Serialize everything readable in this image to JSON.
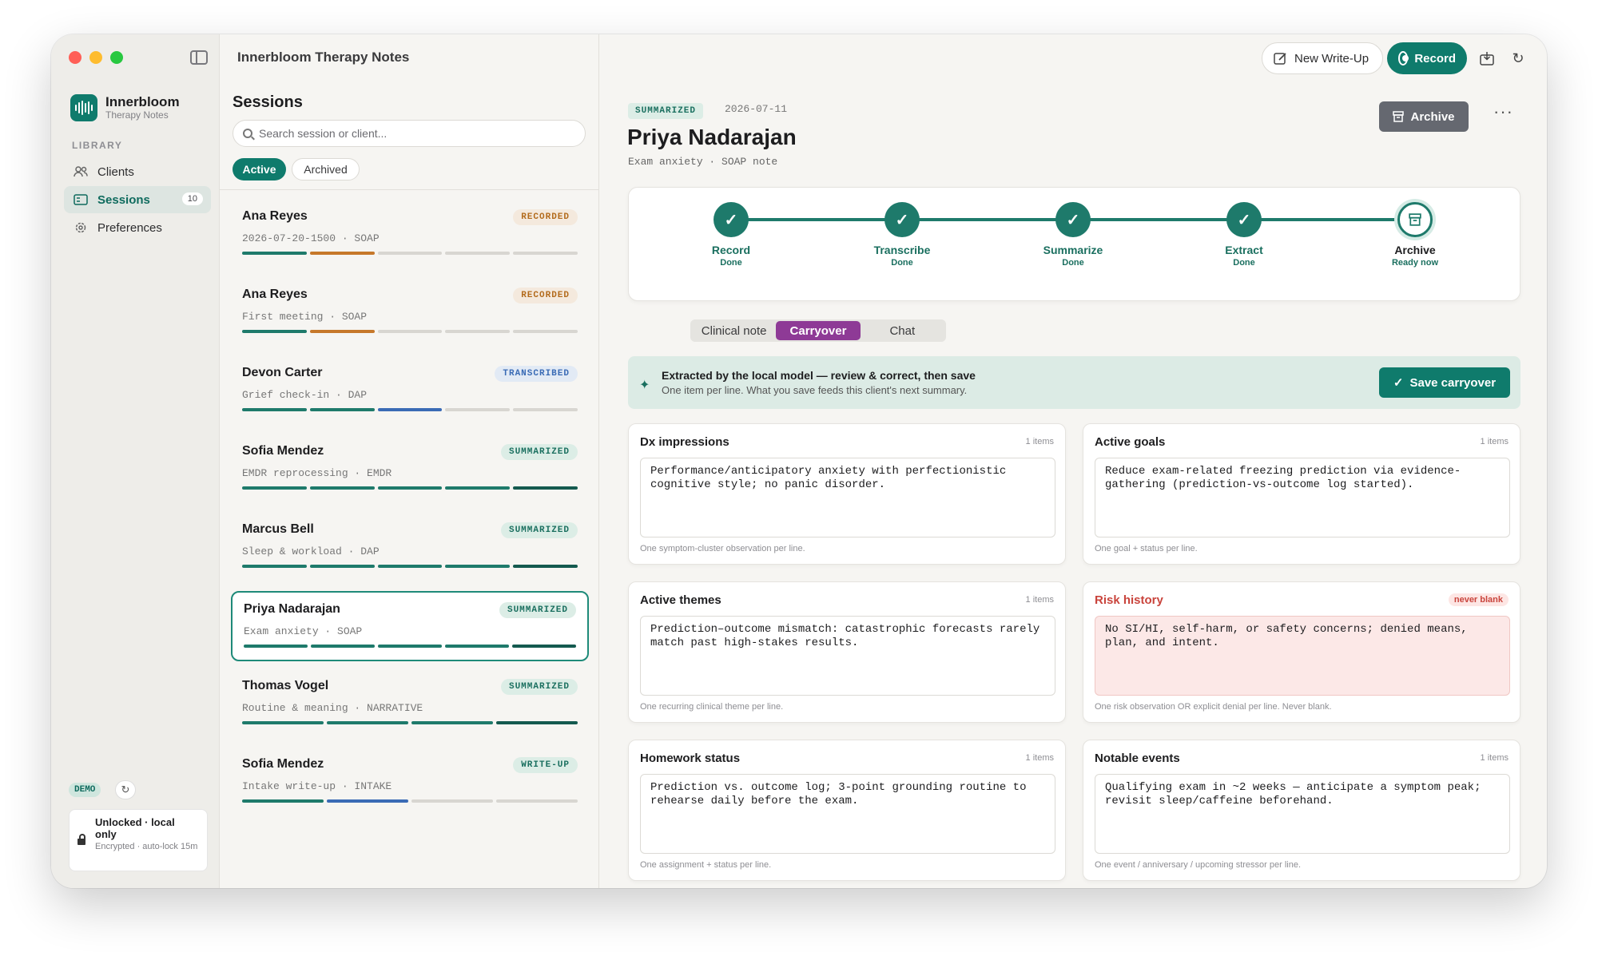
{
  "app_title": "Innerbloom Therapy Notes",
  "brand": {
    "name": "Innerbloom",
    "subtitle": "Therapy Notes"
  },
  "sidebar": {
    "library_label": "LIBRARY",
    "items": [
      {
        "label": "Clients",
        "icon": "clients-icon"
      },
      {
        "label": "Sessions",
        "icon": "sessions-icon",
        "count": "10",
        "active": true
      },
      {
        "label": "Preferences",
        "icon": "gear-icon"
      }
    ],
    "demo_badge": "DEMO",
    "lock": {
      "title": "Unlocked · local only",
      "subtitle": "Encrypted · auto-lock 15m"
    }
  },
  "sessions": {
    "heading": "Sessions",
    "search_placeholder": "Search session or client...",
    "filters": [
      "Active",
      "Archived"
    ],
    "items": [
      {
        "name": "Ana Reyes",
        "sub": "2026-07-20-1500 · SOAP",
        "status": "RECORDED"
      },
      {
        "name": "Ana Reyes",
        "sub": "First meeting · SOAP",
        "status": "RECORDED"
      },
      {
        "name": "Devon Carter",
        "sub": "Grief check-in · DAP",
        "status": "TRANSCRIBED"
      },
      {
        "name": "Sofia Mendez",
        "sub": "EMDR reprocessing · EMDR",
        "status": "SUMMARIZED"
      },
      {
        "name": "Marcus Bell",
        "sub": "Sleep & workload · DAP",
        "status": "SUMMARIZED"
      },
      {
        "name": "Priya Nadarajan",
        "sub": "Exam anxiety · SOAP",
        "status": "SUMMARIZED",
        "selected": true
      },
      {
        "name": "Thomas Vogel",
        "sub": "Routine & meaning · NARRATIVE",
        "status": "SUMMARIZED"
      },
      {
        "name": "Sofia Mendez",
        "sub": "Intake write-up · INTAKE",
        "status": "WRITE-UP"
      }
    ]
  },
  "toolbar": {
    "new_writeup": "New Write-Up",
    "record": "Record"
  },
  "detail": {
    "status": "SUMMARIZED",
    "date": "2026-07-11",
    "client": "Priya Nadarajan",
    "subtitle": "Exam anxiety · SOAP note",
    "archive_label": "Archive",
    "more": "···",
    "pipeline": [
      {
        "label": "Record",
        "status": "Done"
      },
      {
        "label": "Transcribe",
        "status": "Done"
      },
      {
        "label": "Summarize",
        "status": "Done"
      },
      {
        "label": "Extract",
        "status": "Done"
      },
      {
        "label": "Archive",
        "status": "Ready now"
      }
    ],
    "tabs": [
      "Clinical note",
      "Carryover",
      "Chat"
    ],
    "active_tab": "Carryover",
    "banner": {
      "title": "Extracted by the local model — review & correct, then save",
      "subtitle": "One item per line. What you save feeds this client's next summary.",
      "button": "Save carryover"
    },
    "fields": [
      {
        "title": "Dx impressions",
        "count": "1 items",
        "text": "Performance/anticipatory anxiety with perfectionistic\ncognitive style; no panic disorder.",
        "hint": "One symptom-cluster observation per line."
      },
      {
        "title": "Active goals",
        "count": "1 items",
        "text": "Reduce exam-related freezing prediction via evidence-\ngathering (prediction-vs-outcome log started).",
        "hint": "One goal + status per line."
      },
      {
        "title": "Active themes",
        "count": "1 items",
        "text": "Prediction–outcome mismatch: catastrophic forecasts rarely\nmatch past high-stakes results.",
        "hint": "One recurring clinical theme per line."
      },
      {
        "title": "Risk history",
        "count": "never blank",
        "text": "No SI/HI, self-harm, or safety concerns; denied means,\nplan, and intent.",
        "hint": "One risk observation OR explicit denial per line. Never blank."
      },
      {
        "title": "Homework status",
        "count": "1 items",
        "text": "Prediction vs. outcome log; 3-point grounding routine to\nrehearse daily before the exam.",
        "hint": "One assignment + status per line."
      },
      {
        "title": "Notable events",
        "count": "1 items",
        "text": "Qualifying exam in ~2 weeks — anticipate a symptom peak;\nrevisit sleep/caffeine beforehand.",
        "hint": "One event / anniversary / upcoming stressor per line."
      }
    ]
  },
  "colors": {
    "accent": "#0f7b6c",
    "carryover_tab": "#8e3a96",
    "recorded": "#b36b1c",
    "transcribed": "#3a6bb5",
    "risk": "#c9443c"
  }
}
